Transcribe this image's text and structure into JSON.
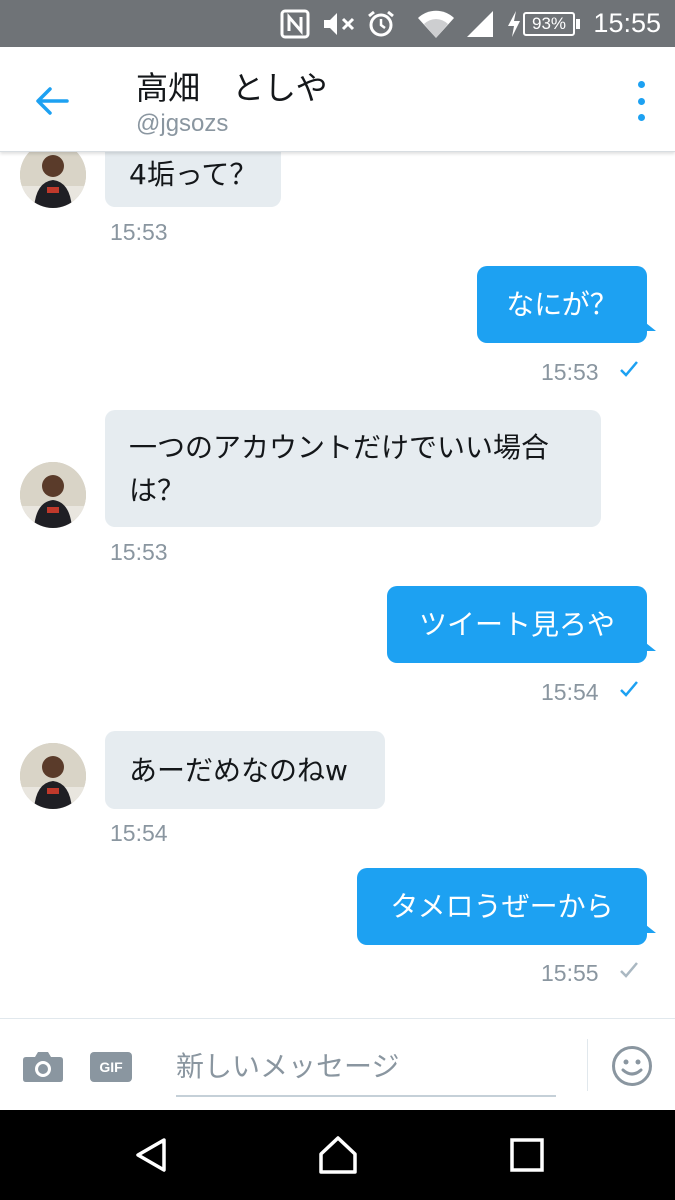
{
  "status_bar": {
    "time": "15:55",
    "battery": "93%",
    "icons": [
      "nfc-icon",
      "mute-icon",
      "alarm-icon",
      "wifi-icon",
      "signal-icon",
      "charging-icon",
      "battery-icon"
    ]
  },
  "header": {
    "name": "高畑　としや",
    "handle": "@jgsozs",
    "accent": "#1da1f2"
  },
  "messages": [
    {
      "direction": "received",
      "text": "4垢って？",
      "time": "15:53"
    },
    {
      "direction": "sent",
      "text": "なにが？",
      "time": "15:53",
      "status": "read"
    },
    {
      "direction": "received",
      "text": "一つのアカウントだけでいい場合は？",
      "time": "15:53"
    },
    {
      "direction": "sent",
      "text": "ツイート見ろや",
      "time": "15:54",
      "status": "read"
    },
    {
      "direction": "received",
      "text": "あーだめなのねw",
      "time": "15:54"
    },
    {
      "direction": "sent",
      "text": "タメロうぜーから",
      "time": "15:55",
      "status": "sent"
    }
  ],
  "composer": {
    "placeholder": "新しいメッセージ",
    "gif_label": "GIF"
  },
  "colors": {
    "sent_bubble": "#1da1f2",
    "received_bubble": "#e6ecf0",
    "timestamp": "#8a96a0"
  }
}
